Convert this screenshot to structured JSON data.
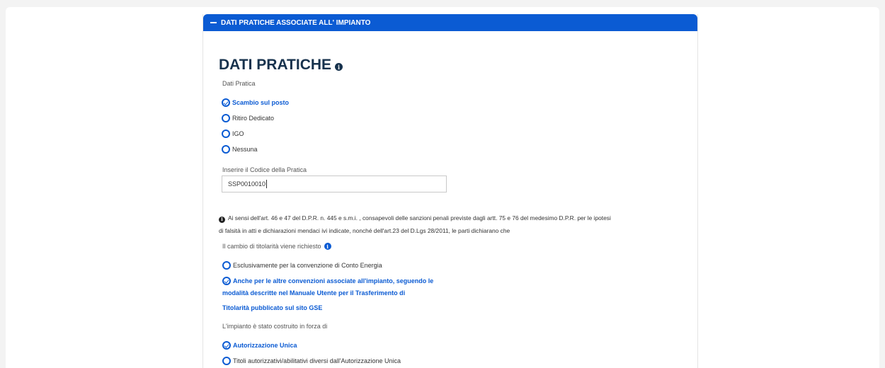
{
  "panel": {
    "header_label": "DATI PRATICHE ASSOCIATE ALL' IMPIANTO",
    "title": "DATI PRATICHE"
  },
  "dati_pratica": {
    "label": "Dati Pratica",
    "options": [
      {
        "label": "Scambio sul posto",
        "selected": true
      },
      {
        "label": "Ritiro Dedicato",
        "selected": false
      },
      {
        "label": "IGO",
        "selected": false
      },
      {
        "label": "Nessuna",
        "selected": false
      }
    ]
  },
  "codice_pratica": {
    "label": "Inserire il Codice della Pratica",
    "value": "SSP0010010"
  },
  "dichiarazione": {
    "line1": "Ai sensi dell'art. 46 e 47 del D.P.R. n. 445 e s.m.i. , consapevoli delle sanzioni penali previste dagli artt. 75 e 76 del medesimo D.P.R. per le ipotesi",
    "line2": "di falsità in atti e dichiarazioni mendaci ivi indicate, nonché dell'art.23 del D.Lgs 28/2011, le parti dichiarano che"
  },
  "cambio_titolarita": {
    "label": "Il cambio di titolarità viene richiesto",
    "option1": "Esclusivamente per la convenzione di Conto Energia",
    "option2_line1": "Anche per le altre convenzioni associate all'impianto, seguendo le",
    "option2_line2": "modalità descritte nel Manuale Utente per il Trasferimento di",
    "option2_line3": "Titolarità pubblicato sul sito GSE"
  },
  "impianto_costruito": {
    "label": "L'impianto è stato costruito in forza di",
    "option1": "Autorizzazione Unica",
    "option2": "Titoli autorizzativi/abilitativi diversi dall'Autorizzazione Unica"
  },
  "colors": {
    "primary": "#0b5bd3",
    "title": "#17324d"
  }
}
